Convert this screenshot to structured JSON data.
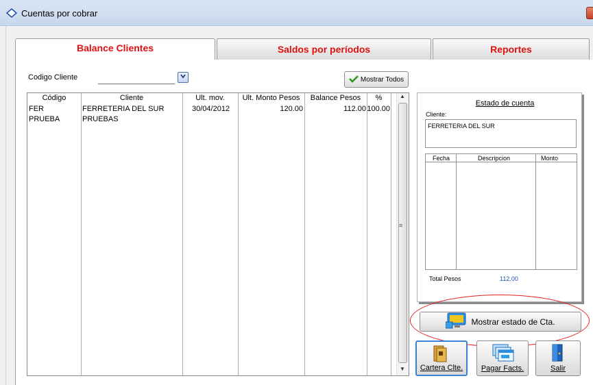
{
  "window": {
    "title": "Cuentas por cobrar"
  },
  "tabs": [
    {
      "label": "Balance Clientes",
      "active": true
    },
    {
      "label": "Saldos por períodos",
      "active": false
    },
    {
      "label": "Reportes",
      "active": false
    }
  ],
  "filter": {
    "codigo_label": "Codigo Cliente",
    "codigo_value": "",
    "mostrar_todos_label": "Mostrar Todos"
  },
  "grid": {
    "columns": [
      "Código",
      "Cliente",
      "Ult. mov.",
      "Ult. Monto Pesos",
      "Balance Pesos",
      "%"
    ],
    "rows": [
      [
        "FER",
        "FERRETERIA DEL SUR",
        "30/04/2012",
        "120.00",
        "112.00",
        "100.00"
      ],
      [
        "PRUEBA",
        "PRUEBAS",
        "",
        "",
        "",
        ""
      ]
    ]
  },
  "estado": {
    "title": "Estado de cuenta",
    "cliente_label": "Cliente:",
    "cliente_value": "FERRETERIA DEL SUR",
    "columns": [
      "Fecha",
      "Descripcion",
      "Monto"
    ],
    "total_label": "Total Pesos",
    "total_value": "112.00"
  },
  "buttons": {
    "mostrar_estado": "Mostrar estado de Cta.",
    "cartera": "Cartera Clte.",
    "pagar": "Pagar Facts.",
    "salir": "Salir"
  },
  "colors": {
    "tab_text": "#e01010",
    "highlight_ellipse": "#e02020",
    "total_value": "#1a4fb0"
  },
  "icons": [
    "app-diamond-icon",
    "close-icon",
    "dropdown-chevron-icon",
    "checkmark-icon",
    "monitor-icon",
    "folder-icon",
    "windows-stack-icon",
    "door-exit-icon"
  ]
}
